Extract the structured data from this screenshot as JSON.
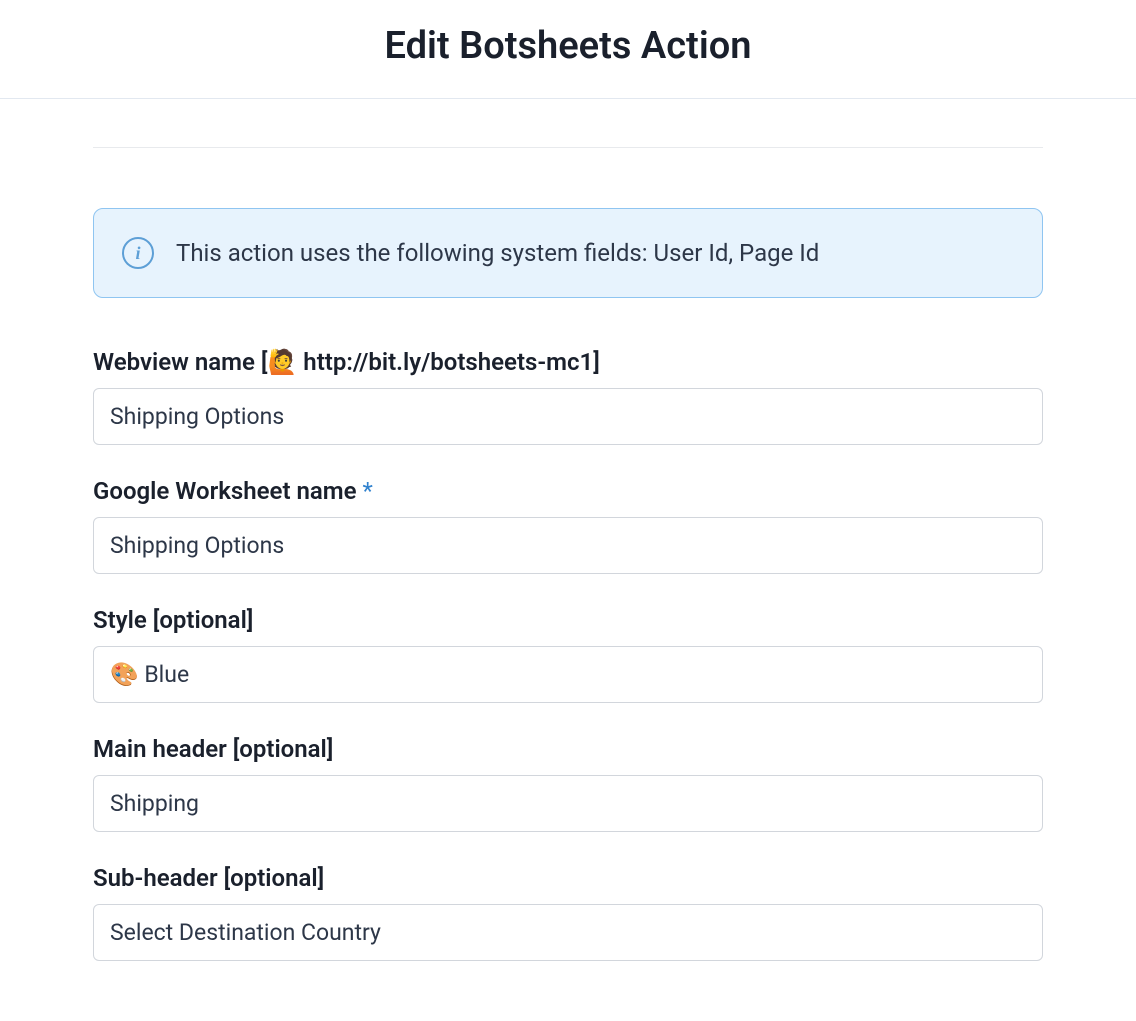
{
  "header": {
    "title": "Edit Botsheets Action"
  },
  "infoBanner": {
    "text": "This action uses the following system fields: User Id, Page Id"
  },
  "fields": {
    "webviewName": {
      "label": "Webview name [🙋 http://bit.ly/botsheets-mc1]",
      "value": "Shipping Options"
    },
    "worksheetName": {
      "label": "Google Worksheet name",
      "required": "*",
      "value": "Shipping Options"
    },
    "style": {
      "label": "Style [optional]",
      "value": "🎨 Blue"
    },
    "mainHeader": {
      "label": "Main header [optional]",
      "value": "Shipping"
    },
    "subHeader": {
      "label": "Sub-header [optional]",
      "value": "Select Destination Country"
    }
  }
}
